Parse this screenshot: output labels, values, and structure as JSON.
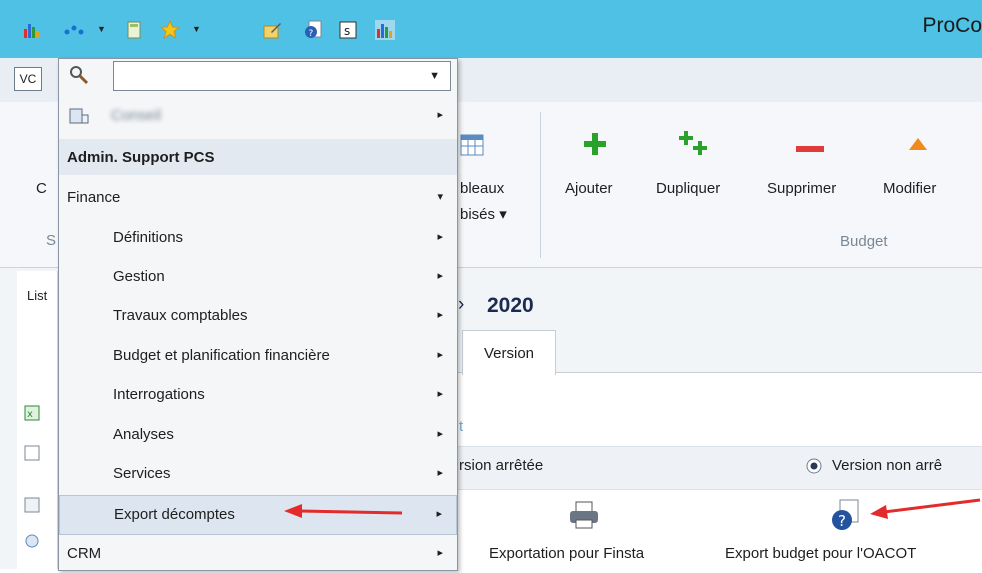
{
  "window": {
    "title": "ProCo"
  },
  "toolbar": {
    "vc_label": "VC"
  },
  "ribbon": {
    "left_c": "C",
    "left_s": "S",
    "tableaux_label1": "bleaux",
    "tableaux_label2": "bisés",
    "buttons": [
      "Ajouter",
      "Dupliquer",
      "Supprimer",
      "Modifier"
    ],
    "group_label": "Budget"
  },
  "menu": {
    "search_placeholder": "",
    "blurred_item": "Conseil",
    "admin_header": "Admin. Support PCS",
    "finance": "Finance",
    "items": [
      "Définitions",
      "Gestion",
      "Travaux comptables",
      "Budget et planification financière",
      "Interrogations",
      "Analyses",
      "Services",
      "Export décomptes"
    ],
    "crm": "CRM"
  },
  "content": {
    "list_label": "List",
    "breadcrumb_year": "2020",
    "tab_version": "Version",
    "t_fragment": "t",
    "radio_left": "rsion arrêtée",
    "radio_right": "Version non arrê",
    "export_finsta": "Exportation pour Finsta",
    "export_oacot": "Export budget pour l'OACOT"
  },
  "colors": {
    "titlebar": "#4fc1e4",
    "arrow": "#e32b2b",
    "plus": "#2aa12a",
    "minus": "#e03b3b"
  }
}
